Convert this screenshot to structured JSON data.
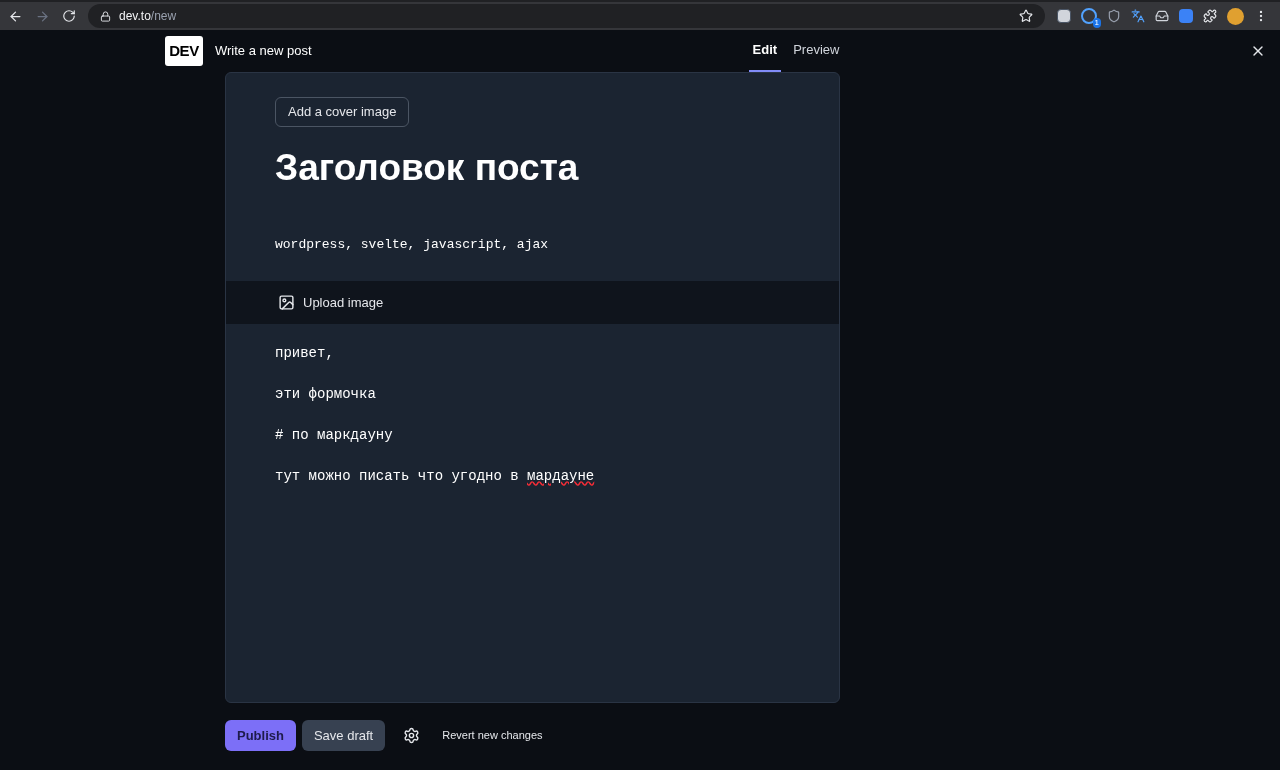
{
  "browser": {
    "url_host": "dev.to",
    "url_path": "/new",
    "extension_badge": "1"
  },
  "header": {
    "logo": "DEV",
    "title": "Write a new post",
    "tabs": [
      {
        "label": "Edit",
        "selected": true
      },
      {
        "label": "Preview",
        "selected": false
      }
    ]
  },
  "editor": {
    "cover_button": "Add a cover image",
    "post_title": "Заголовок поста",
    "tags": "wordpress, svelte, javascript, ajax",
    "toolbar": {
      "upload_button": "Upload image"
    },
    "body": [
      [
        {
          "text": "привет,",
          "misspelled": false
        }
      ],
      [
        {
          "text": "эти формочка",
          "misspelled": false
        }
      ],
      [
        {
          "text": "# по маркдауну",
          "misspelled": false
        }
      ],
      [
        {
          "text": "тут можно писать что угодно в ",
          "misspelled": false
        },
        {
          "text": "мардауне",
          "misspelled": true
        }
      ]
    ]
  },
  "footer": {
    "publish": "Publish",
    "save_draft": "Save draft",
    "revert": "Revert new changes"
  }
}
